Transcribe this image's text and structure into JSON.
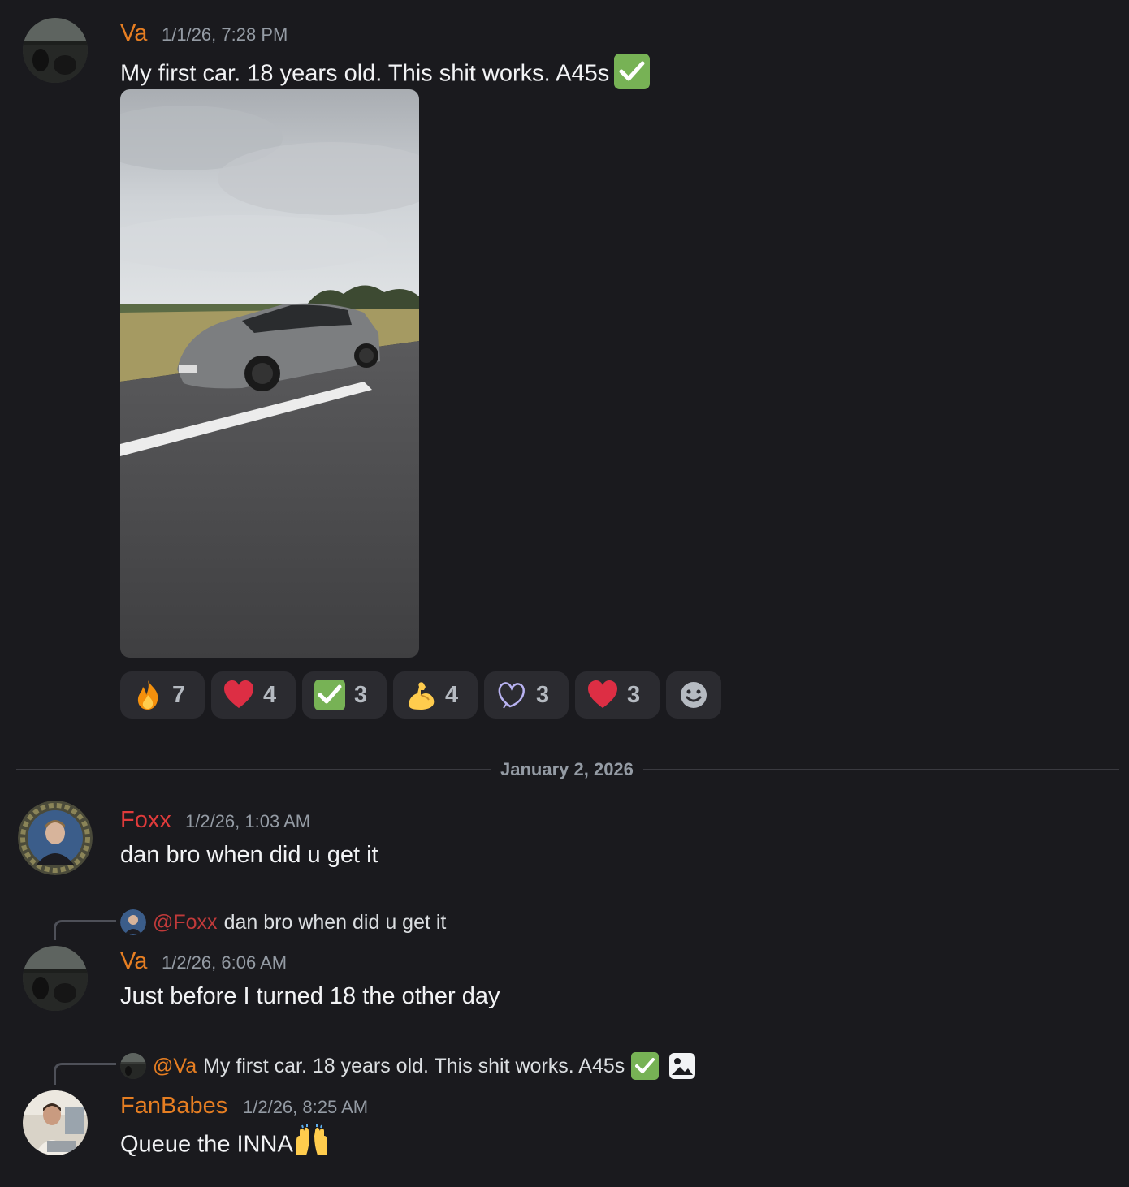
{
  "messages": [
    {
      "author": "Va",
      "timestamp": "1/1/26, 7:28 PM",
      "text": "My first car. 18 years old. This shit works. A45s",
      "image_alt": "Grey hatchback on road",
      "reactions": [
        {
          "emoji": "fire-icon",
          "count": "7"
        },
        {
          "emoji": "heart-icon",
          "count": "4"
        },
        {
          "emoji": "check-icon",
          "count": "3"
        },
        {
          "emoji": "flexed-biceps-icon",
          "count": "4"
        },
        {
          "emoji": "heart-outline-icon",
          "count": "3"
        },
        {
          "emoji": "heart-icon",
          "count": "3"
        }
      ]
    },
    {
      "author": "Foxx",
      "timestamp": "1/2/26, 1:03 AM",
      "text": "dan bro when did u get it"
    },
    {
      "reply_to_name": "@Foxx",
      "reply_to_text": "dan bro when did u get it",
      "author": "Va",
      "timestamp": "1/2/26, 6:06 AM",
      "text": "Just before I turned 18 the other day"
    },
    {
      "reply_to_name": "@Va",
      "reply_to_text": "My first car. 18 years old. This shit works. A45s",
      "author": "FanBabes",
      "timestamp": "1/2/26, 8:25 AM",
      "text": "Queue the INNA"
    }
  ],
  "divider": "January 2, 2026",
  "colors": {
    "background": "#1a1a1e",
    "va": "#e67e22",
    "foxx": "#e03b3b",
    "fanbabes": "#e67e22",
    "check_bg": "#77b255"
  }
}
